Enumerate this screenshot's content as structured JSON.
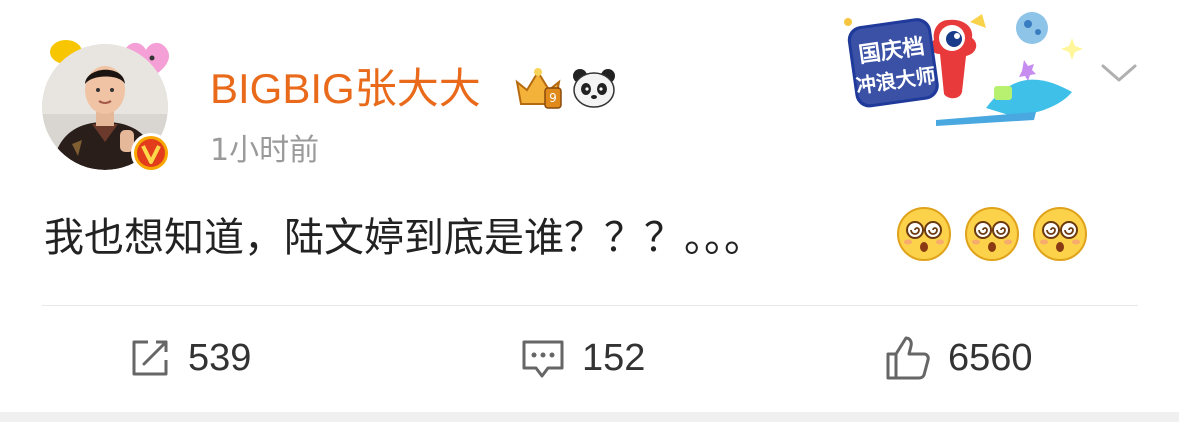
{
  "post": {
    "username": "BIGBIG张大大",
    "time": "1小时前",
    "text": "我也想知道，陆文婷到底是谁？？？。。。",
    "emojis": [
      "dizzy-face-emoji",
      "dizzy-face-emoji",
      "dizzy-face-emoji"
    ]
  },
  "banner": {
    "line1": "国庆档",
    "line2": "冲浪大师"
  },
  "actions": {
    "repost_count": "539",
    "comment_count": "152",
    "like_count": "6560"
  },
  "badges": {
    "verified_letter": "V"
  },
  "colors": {
    "username": "#e86a1a",
    "time": "#9a9a9a",
    "text": "#222222",
    "icon": "#666666",
    "verified": "#f7a700"
  }
}
